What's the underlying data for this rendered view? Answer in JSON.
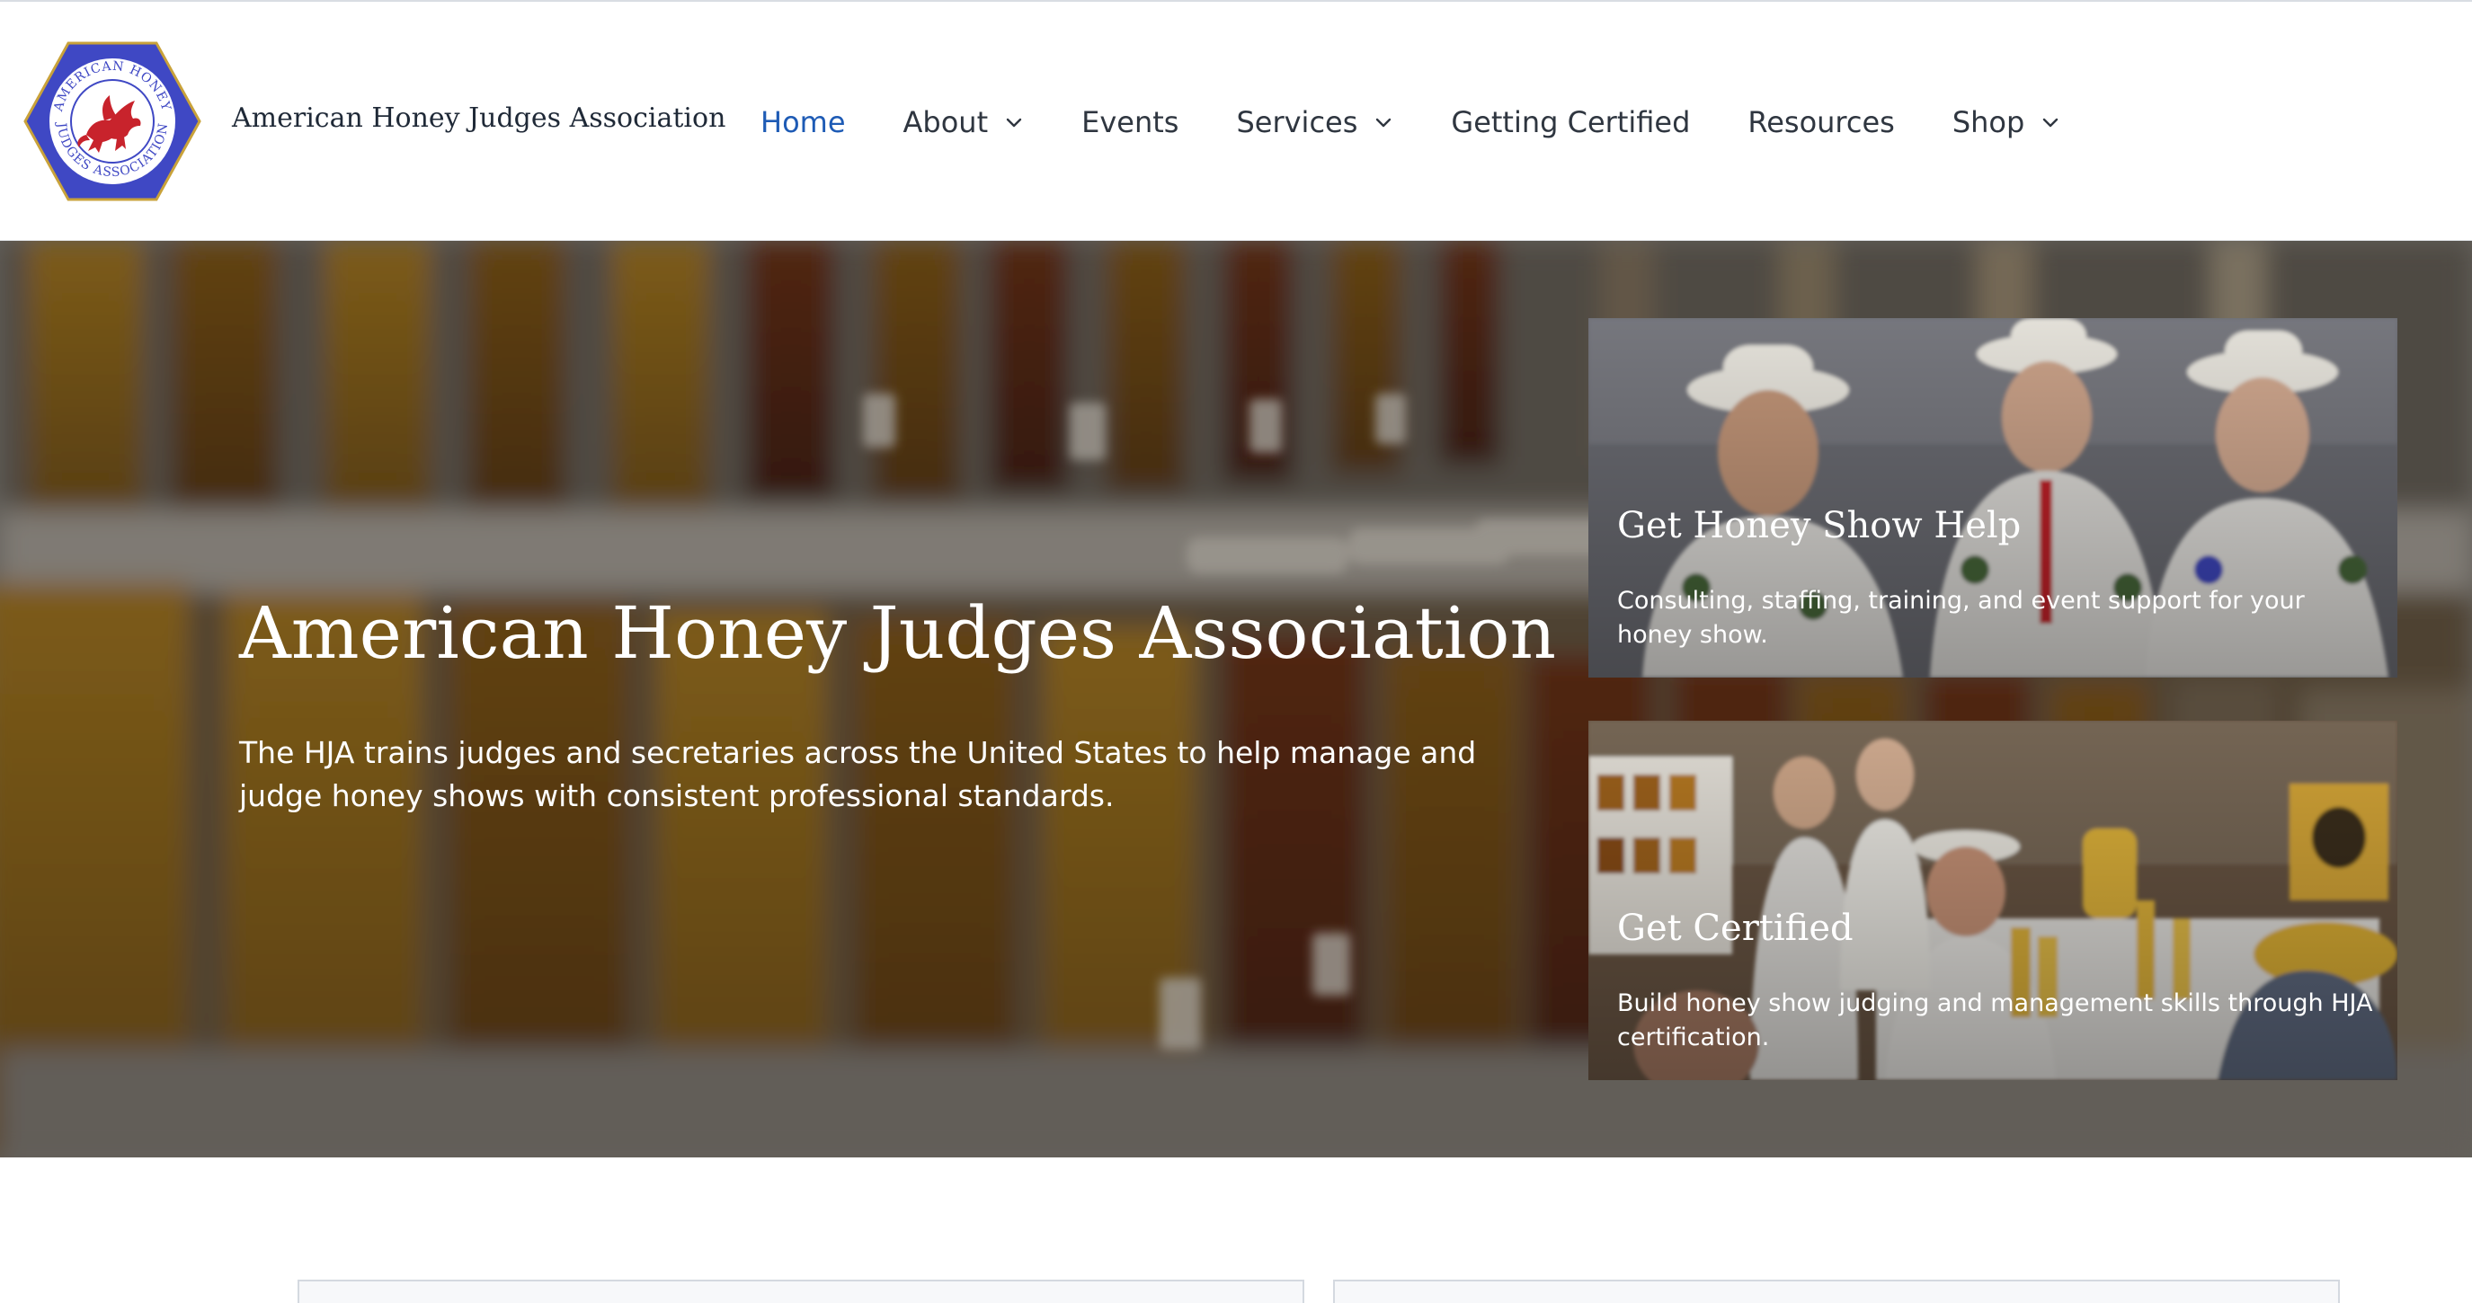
{
  "site": {
    "title": "American Honey Judges Association",
    "logo": {
      "ring_text_top": "AMERICAN HONEY",
      "ring_text_bottom": "JUDGES ASSOCIATION",
      "colors": {
        "hex_fill": "#3f48c4",
        "hex_border": "#c9a23a",
        "ring": "#ffffff",
        "dragon": "#c8232c"
      }
    }
  },
  "nav": {
    "items": [
      {
        "label": "Home",
        "active": true,
        "dropdown": false
      },
      {
        "label": "About",
        "active": false,
        "dropdown": true
      },
      {
        "label": "Events",
        "active": false,
        "dropdown": false
      },
      {
        "label": "Services",
        "active": false,
        "dropdown": true
      },
      {
        "label": "Getting Certified",
        "active": false,
        "dropdown": false
      },
      {
        "label": "Resources",
        "active": false,
        "dropdown": false
      },
      {
        "label": "Shop",
        "active": false,
        "dropdown": true
      }
    ],
    "colors": {
      "active": "#1e5bb5",
      "default": "#2f3640"
    }
  },
  "hero": {
    "title": "American Honey Judges Association",
    "description": "The HJA trains judges and secretaries across the United States to help manage and judge honey shows with consistent professional standards.",
    "cards": [
      {
        "title": "Get Honey Show Help",
        "text": "Consulting, staffing, training, and event support for your honey show."
      },
      {
        "title": "Get Certified",
        "text": "Build honey show judging and management skills through HJA certification."
      }
    ]
  },
  "icons": {
    "dropdown": "chevron-down-icon",
    "logo": "hja-logo"
  }
}
